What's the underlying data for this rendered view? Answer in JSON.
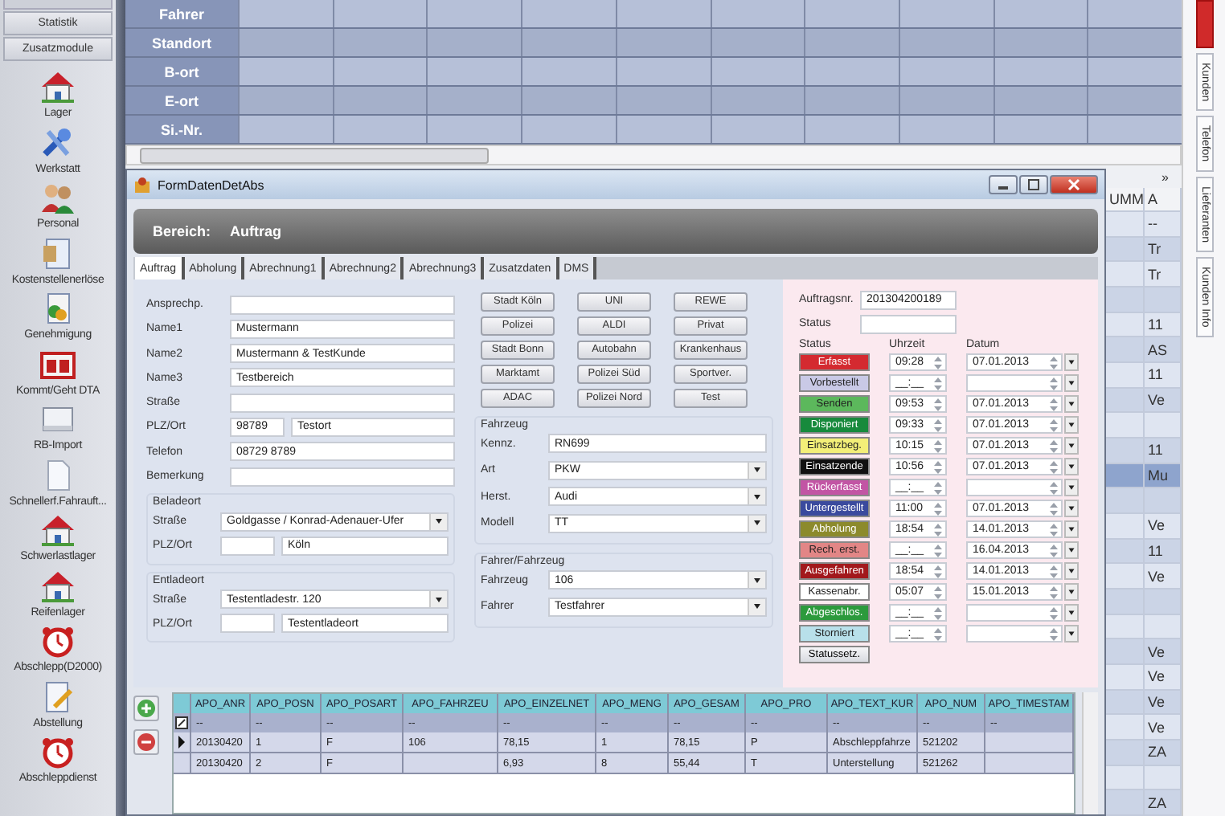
{
  "sidebar": {
    "buttons": [
      "Statistik",
      "Zusatzmodule"
    ],
    "items": [
      {
        "label": "Lager",
        "kind": "house"
      },
      {
        "label": "Werkstatt",
        "kind": "tools"
      },
      {
        "label": "Personal",
        "kind": "people"
      },
      {
        "label": "Kostenstellenerlöse",
        "kind": "document"
      },
      {
        "label": "Genehmigung",
        "kind": "coin"
      },
      {
        "label": "Kommt/Geht DTA",
        "kind": "calendar"
      },
      {
        "label": "RB-Import",
        "kind": "drive"
      },
      {
        "label": "Schnellerf.Fahrauft...",
        "kind": "page"
      },
      {
        "label": "Schwerlastlager",
        "kind": "house"
      },
      {
        "label": "Reifenlager",
        "kind": "house"
      },
      {
        "label": "Abschlepp(D2000)",
        "kind": "alarm"
      },
      {
        "label": "Abstellung",
        "kind": "pencil"
      },
      {
        "label": "Abschleppdienst",
        "kind": "alarm"
      }
    ]
  },
  "grid": {
    "rows": [
      "Fahrer",
      "Standort",
      "B-ort",
      "E-ort",
      "Si.-Nr."
    ]
  },
  "side_tabs": [
    {
      "kind": "alert"
    },
    {
      "kind": "tab",
      "label": "Kunden"
    },
    {
      "kind": "tab",
      "label": "Telefon"
    },
    {
      "kind": "tab",
      "label": "Lieferanten"
    },
    {
      "kind": "tab",
      "label": "Kunden Info"
    }
  ],
  "background_table": {
    "more": "»",
    "columns": [
      "UMM",
      "A"
    ],
    "rows": [
      {
        "cells": [
          null,
          "--"
        ],
        "selected": false
      },
      {
        "cells": [
          null,
          "Tr"
        ],
        "selected": false
      },
      {
        "cells": [
          null,
          "Tr"
        ],
        "selected": false
      },
      {
        "cells": [
          null,
          null
        ],
        "selected": false
      },
      {
        "cells": [
          null,
          "11"
        ],
        "selected": false
      },
      {
        "cells": [
          null,
          "AS"
        ],
        "selected": false
      },
      {
        "cells": [
          null,
          "11"
        ],
        "selected": false
      },
      {
        "cells": [
          null,
          "Ve"
        ],
        "selected": false
      },
      {
        "cells": [
          null,
          null
        ],
        "selected": false
      },
      {
        "cells": [
          null,
          "11"
        ],
        "selected": false
      },
      {
        "cells": [
          null,
          "Mu"
        ],
        "selected": true
      },
      {
        "cells": [
          null,
          null
        ],
        "selected": false
      },
      {
        "cells": [
          null,
          "Ve"
        ],
        "selected": false
      },
      {
        "cells": [
          null,
          "11"
        ],
        "selected": false
      },
      {
        "cells": [
          null,
          "Ve"
        ],
        "selected": false
      },
      {
        "cells": [
          null,
          null
        ],
        "selected": false
      },
      {
        "cells": [
          null,
          null
        ],
        "selected": false
      },
      {
        "cells": [
          null,
          "Ve"
        ],
        "selected": false
      },
      {
        "cells": [
          null,
          "Ve"
        ],
        "selected": false
      },
      {
        "cells": [
          null,
          "Ve"
        ],
        "selected": false
      },
      {
        "cells": [
          null,
          "Ve"
        ],
        "selected": false
      },
      {
        "cells": [
          null,
          "ZA"
        ],
        "selected": false
      },
      {
        "cells": [
          null,
          null
        ],
        "selected": false
      },
      {
        "cells": [
          null,
          "ZA"
        ],
        "selected": false
      }
    ]
  },
  "dialog": {
    "title": "FormDatenDetAbs",
    "header": {
      "label": "Bereich:",
      "value": "Auftrag"
    },
    "tabs": [
      {
        "label": "Auftrag",
        "selected": true
      },
      {
        "label": "Abholung",
        "selected": false
      },
      {
        "label": "Abrechnung1",
        "selected": false
      },
      {
        "label": "Abrechnung2",
        "selected": false
      },
      {
        "label": "Abrechnung3",
        "selected": false
      },
      {
        "label": "Zusatzdaten",
        "selected": false
      },
      {
        "label": "DMS",
        "selected": false
      }
    ],
    "customer": [
      {
        "kind": "text",
        "label": "Ansprechp."
      },
      {
        "kind": "text",
        "label": "Name1",
        "value": "Mustermann"
      },
      {
        "kind": "text",
        "label": "Name2",
        "value": "Mustermann & TestKunde"
      },
      {
        "kind": "text",
        "label": "Name3",
        "value": "Testbereich"
      },
      {
        "kind": "text",
        "label": "Straße"
      },
      {
        "kind": "split",
        "label": "PLZ/Ort",
        "zip": "98789",
        "value": "Testort"
      },
      {
        "kind": "text",
        "label": "Telefon",
        "value": "08729 8789"
      },
      {
        "kind": "text",
        "label": "Bemerkung"
      }
    ],
    "groups": [
      {
        "title": "Beladeort",
        "fields": [
          {
            "kind": "combo",
            "label": "Straße",
            "value": "Goldgasse / Konrad-Adenauer-Ufer"
          },
          {
            "kind": "split",
            "label": "PLZ/Ort",
            "value": "Köln"
          }
        ]
      },
      {
        "title": "Entladeort",
        "fields": [
          {
            "kind": "combo",
            "label": "Straße",
            "value": "Testentladestr. 120"
          },
          {
            "kind": "split",
            "label": "PLZ/Ort",
            "value": "Testentladeort"
          }
        ]
      }
    ],
    "quick_buttons": [
      "Stadt Köln",
      "UNI",
      "REWE",
      "Polizei",
      "ALDI",
      "Privat",
      "Stadt Bonn",
      "Autobahn",
      "Krankenhaus",
      "Marktamt",
      "Polizei Süd",
      "Sportver.",
      "ADAC",
      "Polizei Nord",
      "Test"
    ],
    "vehicle_groups": [
      {
        "title": "Fahrzeug",
        "fields": [
          {
            "kind": "text",
            "label": "Kennz.",
            "value": "RN699"
          },
          {
            "kind": "combo",
            "label": "Art",
            "value": "PKW"
          },
          {
            "kind": "combo",
            "label": "Herst.",
            "value": "Audi"
          },
          {
            "kind": "combo",
            "label": "Modell",
            "value": "TT"
          }
        ]
      },
      {
        "title": "Fahrer/Fahrzeug",
        "fields": [
          {
            "kind": "combo",
            "label": "Fahrzeug",
            "value": "106"
          },
          {
            "kind": "combo",
            "label": "Fahrer",
            "value": "Testfahrer"
          }
        ]
      }
    ],
    "order": {
      "number_label": "Auftragsnr.",
      "number": "201304200189",
      "status_label": "Status"
    },
    "status_columns": [
      "Status",
      "Uhrzeit",
      "Datum"
    ],
    "statuses": [
      {
        "label": "Erfasst",
        "color": "#d42a30",
        "time": "09:28",
        "date": "07.01.2013"
      },
      {
        "label": "Vorbestellt",
        "color": "#c9c9e6",
        "time": "__:__"
      },
      {
        "label": "Senden",
        "color": "#5cb85c",
        "time": "09:53",
        "date": "07.01.2013"
      },
      {
        "label": "Disponiert",
        "color": "#178a3c",
        "time": "09:33",
        "date": "07.01.2013"
      },
      {
        "label": "Einsatzbeg.",
        "color": "#f3ef78",
        "time": "10:15",
        "date": "07.01.2013"
      },
      {
        "label": "Einsatzende",
        "color": "#111111",
        "time": "10:56",
        "date": "07.01.2013"
      },
      {
        "label": "Rückerfasst",
        "color": "#c255a4",
        "time": "__:__"
      },
      {
        "label": "Untergestellt",
        "color": "#3a4a9e",
        "time": "11:00",
        "date": "07.01.2013"
      },
      {
        "label": "Abholung",
        "color": "#8c8a2c",
        "time": "18:54",
        "date": "14.01.2013"
      },
      {
        "label": "Rech. erst.",
        "color": "#e28686",
        "time": "__:__",
        "date": "16.04.2013"
      },
      {
        "label": "Ausgefahren",
        "color": "#a2181c",
        "time": "18:54",
        "date": "14.01.2013"
      },
      {
        "label": "Kassenabr.",
        "color": "#ffffff",
        "time": "05:07",
        "date": "15.01.2013"
      },
      {
        "label": "Abgeschlos.",
        "color": "#2c9a3c",
        "time": "__:__"
      },
      {
        "label": "Storniert",
        "color": "#b8e0ea",
        "time": "__:__"
      }
    ],
    "status_set_button": "Statussetz.",
    "positions": {
      "columns": [
        "APO_ANR",
        "APO_POSN",
        "APO_POSART",
        "APO_FAHRZEU",
        "APO_EINZELNET",
        "APO_MENG",
        "APO_GESAM",
        "APO_PRO",
        "APO_TEXT_KUR",
        "APO_NUM",
        "APO_TIMESTAM"
      ],
      "filter_row": [
        "--",
        "--",
        "--",
        "--",
        "--",
        "--",
        "--",
        "--",
        "--",
        "--",
        "--"
      ],
      "rows": [
        {
          "selected": true,
          "cells": [
            "20130420",
            "1",
            "F",
            "106",
            "78,15",
            "1",
            "78,15",
            "P",
            "Abschleppfahrze",
            "521202",
            null
          ]
        },
        {
          "selected": false,
          "cells": [
            "20130420",
            "2",
            "F",
            null,
            "6,93",
            "8",
            "55,44",
            "T",
            "Unterstellung",
            "521262",
            null
          ]
        }
      ]
    }
  }
}
